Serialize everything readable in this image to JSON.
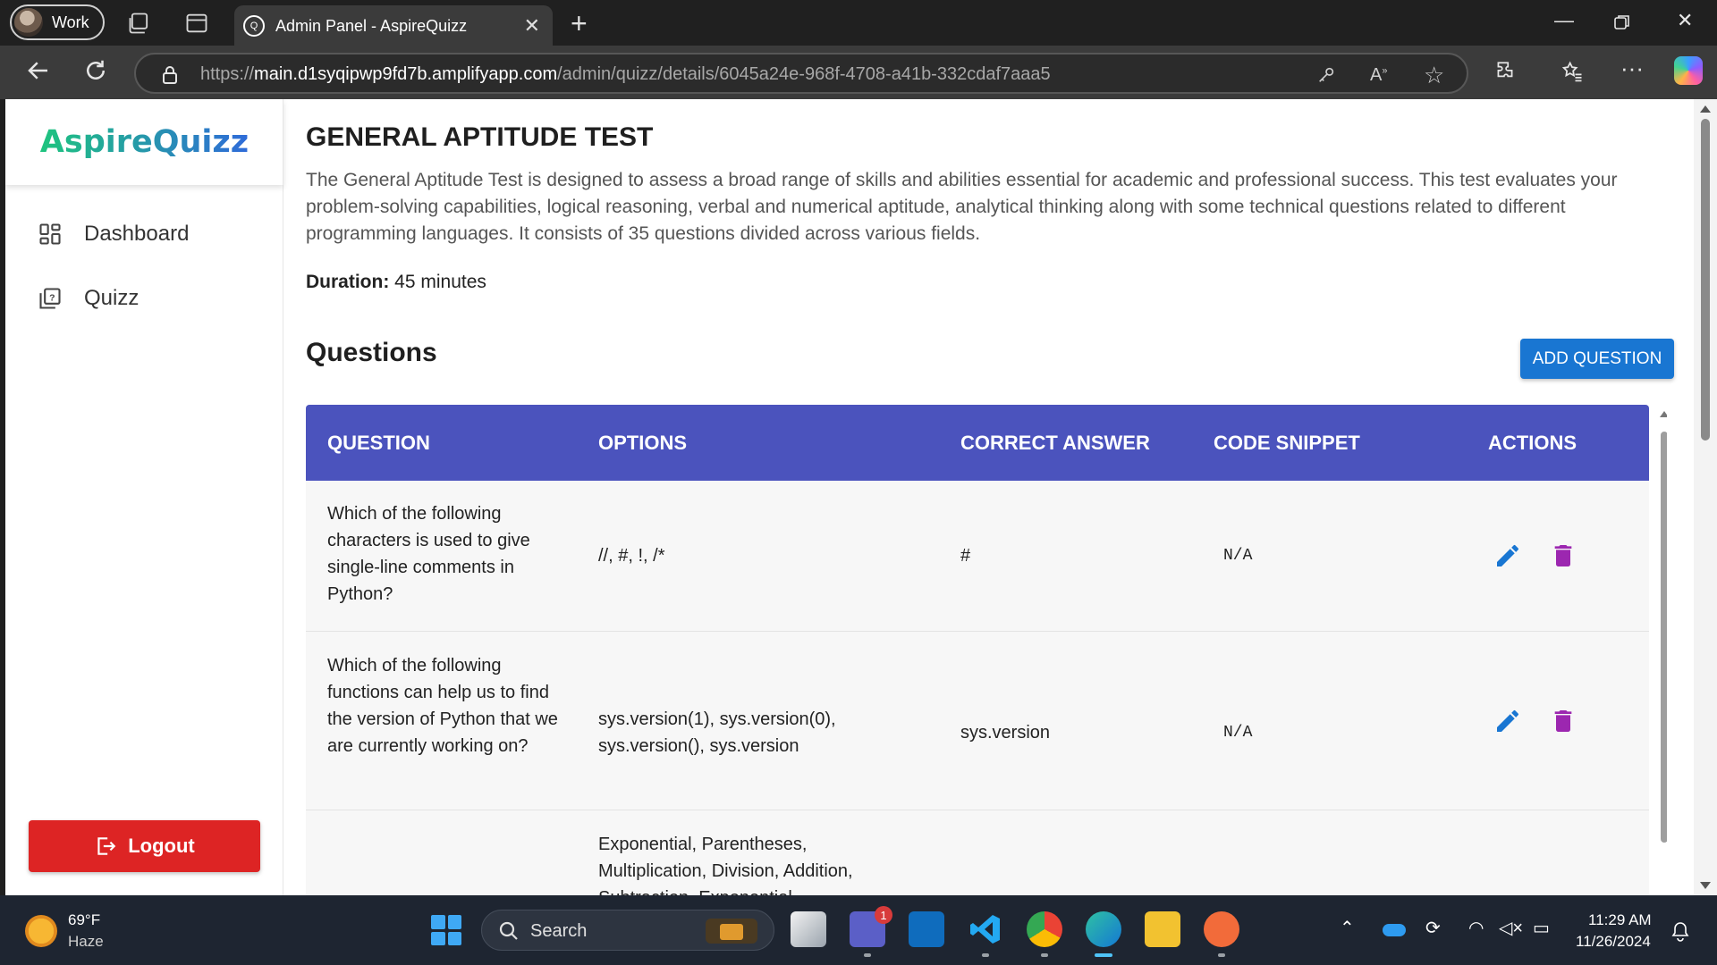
{
  "browser": {
    "profile_name": "Work",
    "tab_title": "Admin Panel - AspireQuizz",
    "url_scheme": "https://",
    "url_host": "main.d1syqipwp9fd7b.amplifyapp.com",
    "url_path": "/admin/quizz/details/6045a24e-968f-4708-a41b-332cdaf7aaa5"
  },
  "sidebar": {
    "brand": "AspireQuizz",
    "items": [
      {
        "label": "Dashboard",
        "icon": "dashboard-icon"
      },
      {
        "label": "Quizz",
        "icon": "quiz-icon"
      }
    ],
    "logout_label": "Logout"
  },
  "quiz": {
    "title": "GENERAL APTITUDE TEST",
    "description": "The General Aptitude Test is designed to assess a broad range of skills and abilities essential for academic and professional success. This test evaluates your problem-solving capabilities, logical reasoning, verbal and numerical aptitude, analytical thinking along with some technical questions related to different programming languages. It consists of 35 questions divided across various fields.",
    "duration_label": "Duration:",
    "duration_value": "45 minutes"
  },
  "questions": {
    "heading": "Questions",
    "add_button": "ADD QUESTION",
    "columns": [
      "QUESTION",
      "OPTIONS",
      "CORRECT ANSWER",
      "CODE SNIPPET",
      "ACTIONS"
    ],
    "rows": [
      {
        "question": "Which of the following characters is used to give single-line comments in Python?",
        "options": "//, #, !, /*",
        "answer": "#",
        "snippet": "N/A"
      },
      {
        "question": "Which of the following functions can help us to find the version of Python that we are currently working on?",
        "options": "sys.version(1), sys.version(0), sys.version(), sys.version",
        "answer": "sys.version",
        "snippet": "N/A"
      },
      {
        "question": "",
        "options": "Exponential, Parentheses, Multiplication, Division, Addition, Subtraction, Exponential",
        "answer": "",
        "snippet": ""
      }
    ]
  },
  "taskbar": {
    "temperature": "69°F",
    "weather": "Haze",
    "search_label": "Search",
    "teams_badge": "1",
    "time": "11:29 AM",
    "date": "11/26/2024"
  },
  "colors": {
    "table_header": "#4b53bd",
    "add_button": "#1976d2",
    "logout_button": "#dd2424",
    "edit_icon": "#1976d2",
    "delete_icon": "#9c27b0"
  }
}
